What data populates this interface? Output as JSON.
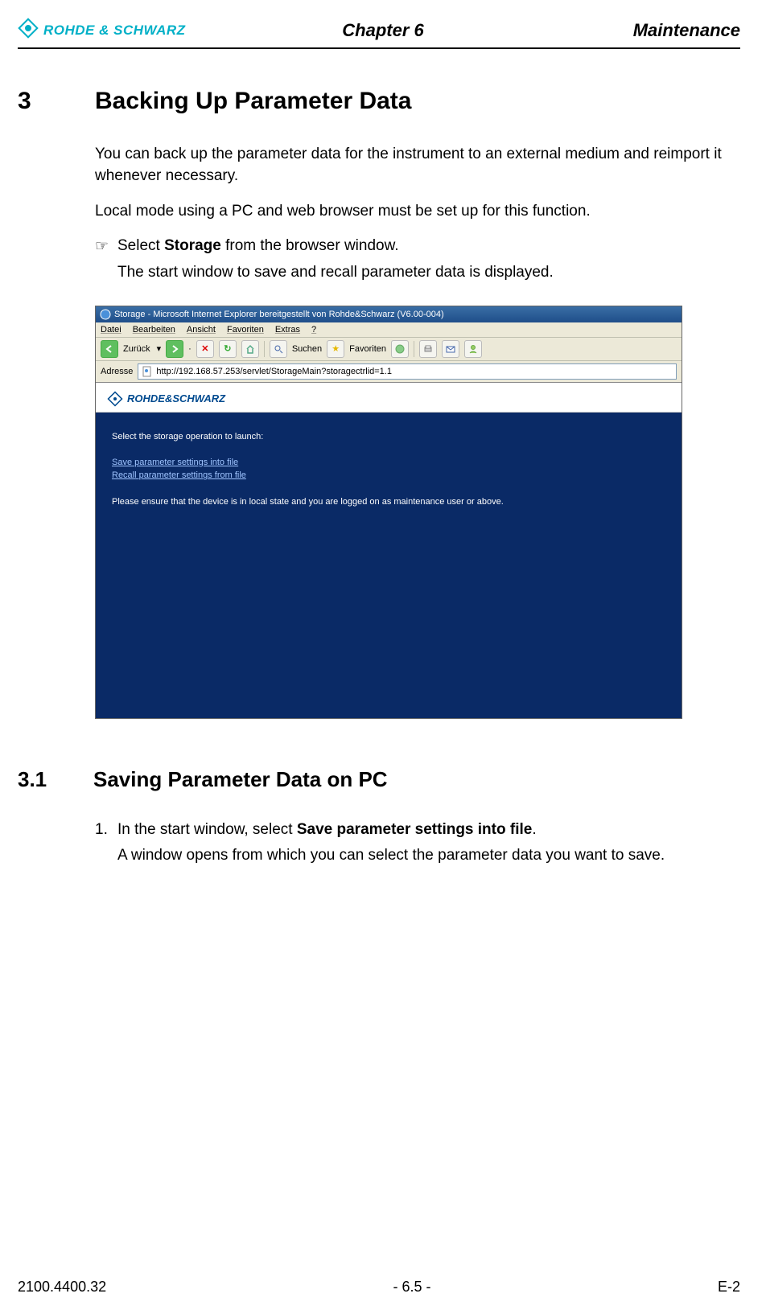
{
  "header": {
    "logo_text": "ROHDE & SCHWARZ",
    "chapter": "Chapter 6",
    "section_name": "Maintenance"
  },
  "section3": {
    "number": "3",
    "title": "Backing Up Parameter Data",
    "p1": "You can back up the parameter data for the instrument to an external medium and reimport it whenever necessary.",
    "p2": "Local mode using a PC and web browser must be set up for this function.",
    "step_marker": "☞",
    "step_pre": "Select ",
    "step_bold": "Storage",
    "step_post": " from the browser window.",
    "step_result": "The start window to save and recall parameter data is displayed."
  },
  "screenshot": {
    "title": "Storage - Microsoft Internet Explorer bereitgestellt von Rohde&Schwarz (V6.00-004)",
    "menu": {
      "m1": "Datei",
      "m2": "Bearbeiten",
      "m3": "Ansicht",
      "m4": "Favoriten",
      "m5": "Extras",
      "m6": "?"
    },
    "toolbar": {
      "back": "Zurück",
      "search": "Suchen",
      "fav": "Favoriten"
    },
    "addr_label": "Adresse",
    "addr_url": "http://192.168.57.253/servlet/StorageMain?storagectrlid=1.1",
    "brand": "ROHDE&SCHWARZ",
    "prompt": "Select the storage operation to launch:",
    "link1": "Save parameter settings into file",
    "link2": "Recall parameter settings from file",
    "note": "Please ensure that the device is in local state and you are logged on as maintenance user or above."
  },
  "section31": {
    "number": "3.1",
    "title": "Saving Parameter Data on PC",
    "step_num": "1.",
    "step_pre": "In the start window, select ",
    "step_bold": "Save parameter settings into file",
    "step_post": ".",
    "step_result": "A window opens from which you can select the parameter data you want to save."
  },
  "footer": {
    "left": "2100.4400.32",
    "center": "- 6.5 -",
    "right": "E-2"
  }
}
